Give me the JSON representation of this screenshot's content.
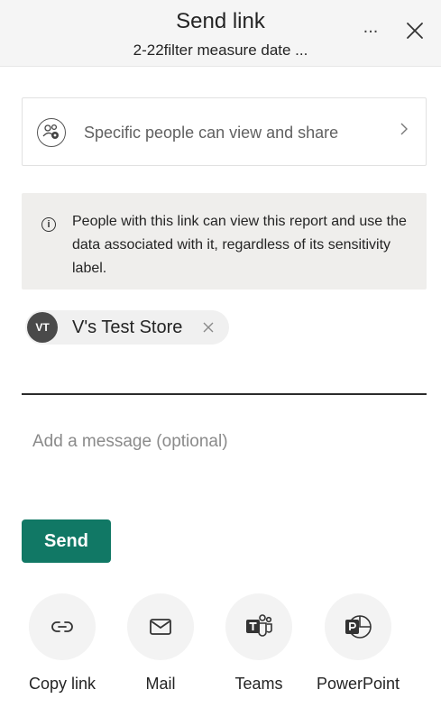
{
  "header": {
    "title": "Send link",
    "subtitle": "2-22filter measure date ...",
    "more_label": "..."
  },
  "permission": {
    "text": "Specific people can view and share"
  },
  "info": {
    "icon_glyph": "i",
    "text": "People with this link can view this report and use the data associated with it, regardless of its sensitivity label."
  },
  "recipient": {
    "initials": "VT",
    "name": "V's Test Store"
  },
  "message": {
    "placeholder": "Add a message (optional)"
  },
  "send_label": "Send",
  "share_options": [
    {
      "label": "Copy link",
      "icon": "link-icon"
    },
    {
      "label": "Mail",
      "icon": "mail-icon"
    },
    {
      "label": "Teams",
      "icon": "teams-icon"
    },
    {
      "label": "PowerPoint",
      "icon": "powerpoint-icon"
    }
  ],
  "colors": {
    "send_button": "#117865",
    "header_bg": "#f5f5f5",
    "info_bg": "#efeeec"
  }
}
